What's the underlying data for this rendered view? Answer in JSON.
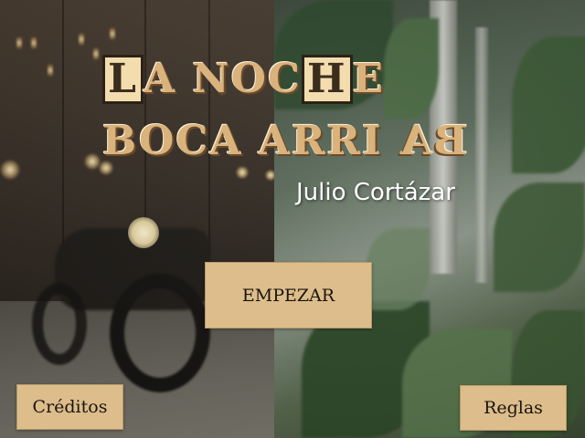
{
  "title": {
    "line1_boxed": "L",
    "line1_a": "A NOC",
    "line1_boxed2": "H",
    "line1_b": "E",
    "line2_a": "BOCA ARRI",
    "line2_flipped": "BA"
  },
  "author": "Julio Cortázar",
  "buttons": {
    "start": "EMPEZAR",
    "credits": "Créditos",
    "rules": "Reglas"
  },
  "colors": {
    "button_bg": "#dcbd8b",
    "title_gold": "#d9b27c",
    "author_text": "#ffffff"
  }
}
